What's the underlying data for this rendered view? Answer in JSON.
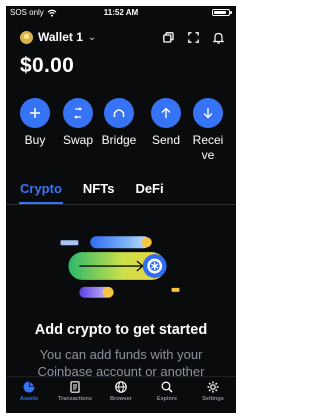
{
  "status_bar": {
    "carrier": "SOS only",
    "time": "11:52 AM"
  },
  "header": {
    "wallet_name": "Wallet 1"
  },
  "balance": "$0.00",
  "actions": [
    {
      "label": "Buy"
    },
    {
      "label": "Swap"
    },
    {
      "label": "Bridge"
    },
    {
      "label": "Send"
    },
    {
      "label": "Receive"
    }
  ],
  "tabs": [
    {
      "label": "Crypto",
      "active": true
    },
    {
      "label": "NFTs",
      "active": false
    },
    {
      "label": "DeFi",
      "active": false
    }
  ],
  "empty_state": {
    "title": "Add crypto to get started",
    "subtitle": "You can add funds with your Coinbase account or another"
  },
  "bottom_nav": [
    {
      "label": "Assets",
      "icon": "pie-chart-icon",
      "active": true
    },
    {
      "label": "Transactions",
      "icon": "document-icon",
      "active": false
    },
    {
      "label": "Browser",
      "icon": "globe-icon",
      "active": false
    },
    {
      "label": "Explore",
      "icon": "search-icon",
      "active": false
    },
    {
      "label": "Settings",
      "icon": "gear-icon",
      "active": false
    }
  ],
  "colors": {
    "accent": "#3773f5",
    "background": "#0a0b0d",
    "muted_text": "#8a919e"
  }
}
